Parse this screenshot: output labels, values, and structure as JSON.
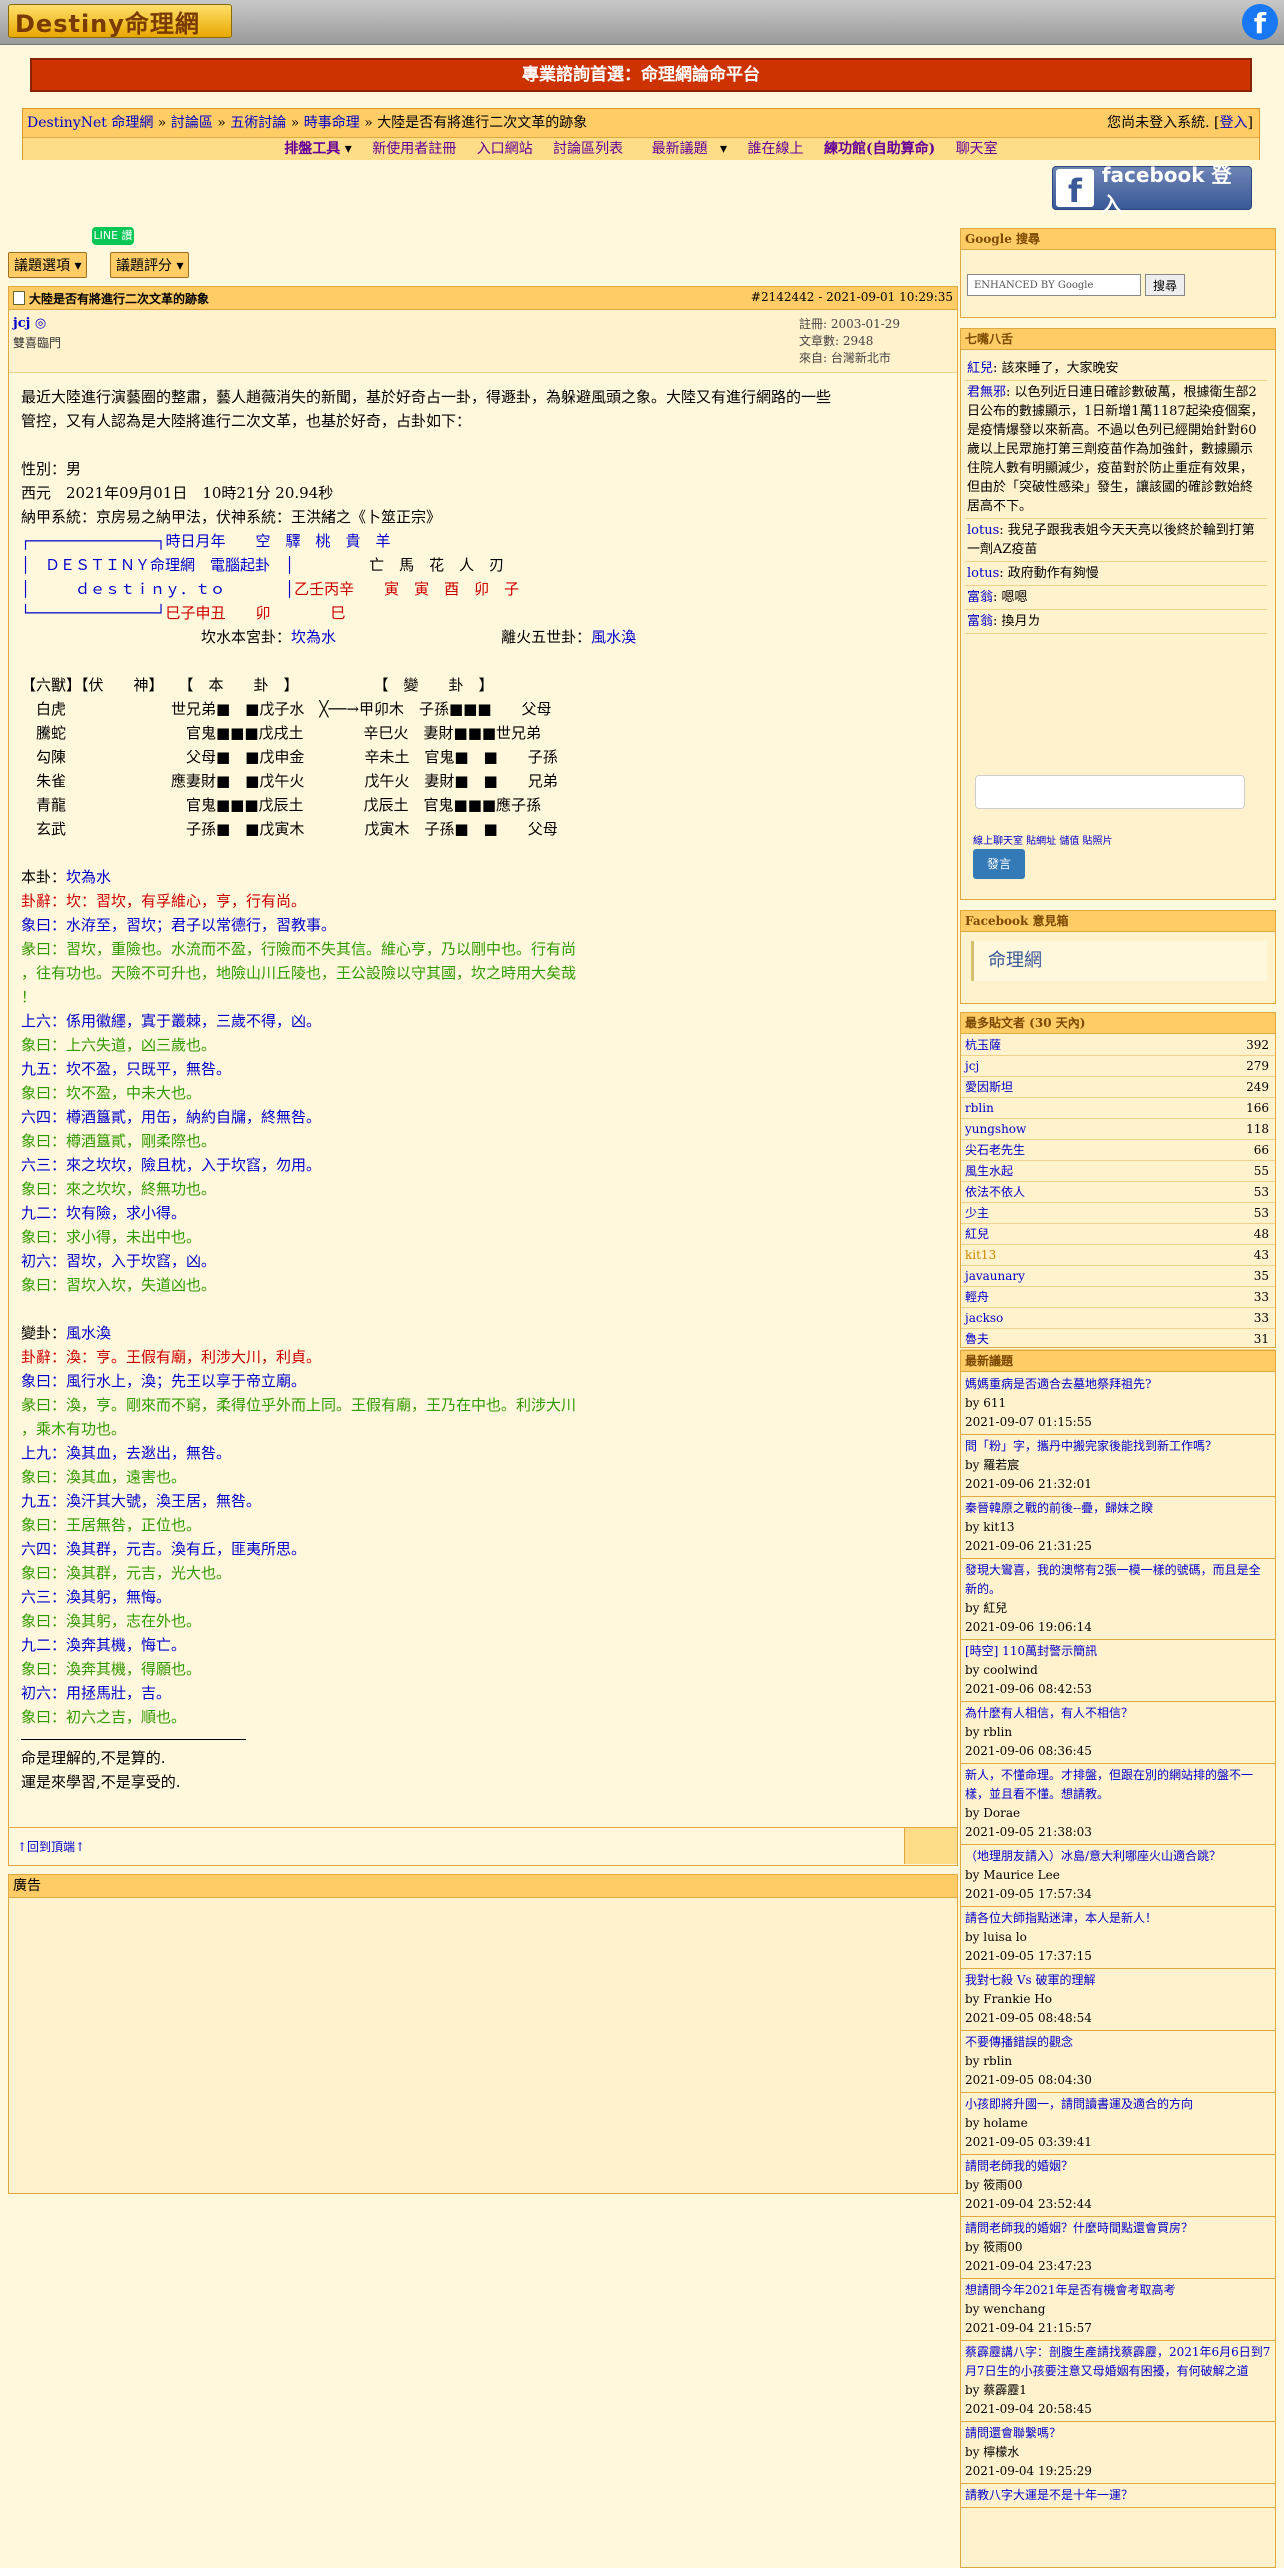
{
  "site": {
    "logo": "Destiny命理網",
    "fb_icon": "f"
  },
  "banner": "專業諮詢首選：命理網論命平台",
  "breadcrumb": {
    "home": "DestinyNet 命理網",
    "forum": "討論區",
    "arts": "五術討論",
    "topic": "時事命理",
    "sep": "»",
    "current": "大陸是否有將進行二次文革的跡象"
  },
  "login_status": {
    "text": "您尚未登入系統. [",
    "link": "登入",
    "close": "]"
  },
  "menu": [
    "排盤工具",
    "新使用者註冊",
    "入口網站",
    "討論區列表",
    "最新議題",
    "誰在線上",
    "練功館(自助算命)",
    "聊天室"
  ],
  "fb_login": "facebook 登入",
  "line_badge": "LINE 讚",
  "topic_options": "議題選項",
  "topic_rating": "議題評分",
  "post": {
    "title": "大陸是否有將進行二次文革的跡象",
    "id_time": "#2142442 - 2021-09-01 10:29:35",
    "author": "jcj",
    "group": "雙喜臨門",
    "reg": "註冊: 2003-01-29",
    "posts": "文章數: 2948",
    "from": "來自: 台灣新北市",
    "intro1": "最近大陸進行演藝圈的整肅，藝人趙薇消失的新聞，基於好奇占一卦，得遯卦，為躲避風頭之象。大陸又有進行網路的一些",
    "intro2": "管控，又有人認為是大陸將進行二次文革，也基於好奇，占卦如下：",
    "sex": "性別：男",
    "date": "西元　2021年09月01日　10時21分 20.94秒",
    "najia": "納甲系統：京房易之納甲法，伏神系統：王洪緒之《卜筮正宗》",
    "box1": "┌──────────────┐時日月年　　空　驛　桃　貴　羊",
    "box2a": "│　ＤＥＳＴＩＮＹ命理網　電腦起卦　│",
    "box2b": "　　　　　亡　馬　花　人　刃",
    "box3a": "│　　　ｄｅｓｔｉｎｙ．ｔｏ　　　　│",
    "box3b": "乙壬丙辛　　寅　寅　酉　卯　子",
    "box4a": "└──────────────┘",
    "box4b": "巳子申丑　　卯　　　　巳",
    "palace_left": "坎水本宮卦：",
    "palace_left_v": "坎為水",
    "palace_right": "離火五世卦：",
    "palace_right_v": "風水渙",
    "table_head": "【六獸】【伏　　神】　　【　本　　卦　】　　　　　　【　變　　卦　】",
    "rows": [
      "　白虎　　　　　　　世兄弟■　■戊子水　╳──→甲卯木　子孫■■■　　父母",
      "　騰蛇　　　　　　　　官鬼■■■戊戌土　　　　辛巳火　妻財■■■世兄弟",
      "　勾陳　　　　　　　　父母■　■戊申金　　　　辛未土　官鬼■　■　　子孫",
      "　朱雀　　　　　　　應妻財■　■戊午火　　　　戊午火　妻財■　■　　兄弟",
      "　青龍　　　　　　　　官鬼■■■戊辰土　　　　戊辰土　官鬼■■■應子孫",
      "　玄武　　　　　　　　子孫■　■戊寅木　　　　戊寅木　子孫■　■　　父母"
    ],
    "ben_label": "本卦：",
    "ben_name": "坎為水",
    "ben_lines": [
      [
        "red",
        "卦辭：坎：習坎，有孚維心，亨，行有尚。"
      ],
      [
        "blue",
        "象曰：水洊至，習坎；君子以常德行，習教事。"
      ],
      [
        "green",
        "彖曰：習坎，重險也。水流而不盈，行險而不失其信。維心亨，乃以剛中也。行有尚"
      ],
      [
        "green",
        "，往有功也。天險不可升也，地險山川丘陵也，王公設險以守其國，坎之時用大矣哉"
      ],
      [
        "green",
        "！"
      ],
      [
        "blue",
        "上六：係用徽纆，寘于叢棘，三歲不得，凶。"
      ],
      [
        "green",
        "象曰：上六失道，凶三歲也。"
      ],
      [
        "blue",
        "九五：坎不盈，只既平，無咎。"
      ],
      [
        "green",
        "象曰：坎不盈，中未大也。"
      ],
      [
        "blue",
        "六四：樽酒簋貳，用缶，納約自牖，終無咎。"
      ],
      [
        "green",
        "象曰：樽酒簋貳，剛柔際也。"
      ],
      [
        "blue",
        "六三：來之坎坎，險且枕，入于坎窞，勿用。"
      ],
      [
        "green",
        "象曰：來之坎坎，終無功也。"
      ],
      [
        "blue",
        "九二：坎有險，求小得。"
      ],
      [
        "green",
        "象曰：求小得，未出中也。"
      ],
      [
        "blue",
        "初六：習坎，入于坎窞，凶。"
      ],
      [
        "green",
        "象曰：習坎入坎，失道凶也。"
      ]
    ],
    "bian_label": "變卦：",
    "bian_name": "風水渙",
    "bian_lines": [
      [
        "red",
        "卦辭：渙：亨。王假有廟，利涉大川，利貞。"
      ],
      [
        "blue",
        "象曰：風行水上，渙；先王以享于帝立廟。"
      ],
      [
        "green",
        "彖曰：渙，亨。剛來而不窮，柔得位乎外而上同。王假有廟，王乃在中也。利涉大川"
      ],
      [
        "green",
        "，乘木有功也。"
      ],
      [
        "blue",
        "上九：渙其血，去逖出，無咎。"
      ],
      [
        "green",
        "象曰：渙其血，遠害也。"
      ],
      [
        "blue",
        "九五：渙汗其大號，渙王居，無咎。"
      ],
      [
        "green",
        "象曰：王居無咎，正位也。"
      ],
      [
        "blue",
        "六四：渙其群，元吉。渙有丘，匪夷所思。"
      ],
      [
        "green",
        "象曰：渙其群，元吉，光大也。"
      ],
      [
        "blue",
        "六三：渙其躬，無悔。"
      ],
      [
        "green",
        "象曰：渙其躬，志在外也。"
      ],
      [
        "blue",
        "九二：渙奔其機，悔亡。"
      ],
      [
        "green",
        "象曰：渙奔其機，得願也。"
      ],
      [
        "blue",
        "初六：用拯馬壯，吉。"
      ],
      [
        "green",
        "象曰：初六之吉，順也。"
      ]
    ],
    "sig1": "命是理解的,不是算的.",
    "sig2": "運是來學習,不是享受的.",
    "to_top": "↑回到頂端↑"
  },
  "ad_label": "廣告",
  "google": {
    "header": "Google 搜尋",
    "placeholder": "ENHANCED BY Google",
    "button": "搜尋"
  },
  "chat": {
    "header": "七嘴八舌",
    "messages": [
      [
        "紅兒",
        "該來睡了，大家晚安"
      ],
      [
        "君無邪",
        "以色列近日連日確診數破萬，根據衛生部2日公布的數據顯示，1日新增1萬1187起染疫個案，是疫情爆發以來新高。不過以色列已經開始針對60歲以上民眾施打第三劑疫苗作為加強針，數據顯示住院人數有明顯減少，疫苗對於防止重症有效果，但由於「突破性感染」發生，讓該國的確診數始終居高不下。"
      ],
      [
        "lotus",
        "我兒子跟我表姐今天天亮以後終於輪到打第一劑AZ疫苗"
      ],
      [
        "lotus",
        "政府動作有夠慢"
      ],
      [
        "富翁",
        "嗯嗯"
      ],
      [
        "富翁",
        "換月ㄌ"
      ]
    ],
    "links": "線上聊天室 貼網址 儲值 貼照片",
    "send": "發言"
  },
  "fb_fans": {
    "header": "Facebook 意見箱",
    "name": "命理網"
  },
  "top_posters": {
    "header": "最多貼文者 (30 天內)",
    "rows": [
      [
        "杭玉薩",
        "392"
      ],
      [
        "jcj",
        "279"
      ],
      [
        "愛因斯坦",
        "249"
      ],
      [
        "rblin",
        "166"
      ],
      [
        "yungshow",
        "118"
      ],
      [
        "尖石老先生",
        "66"
      ],
      [
        "風生水起",
        "55"
      ],
      [
        "依法不依人",
        "53"
      ],
      [
        "少主",
        "53"
      ],
      [
        "紅兒",
        "48"
      ],
      [
        "kit13",
        "43"
      ],
      [
        "javaunary",
        "35"
      ],
      [
        "輕舟",
        "33"
      ],
      [
        "jackso",
        "33"
      ],
      [
        "魯夫",
        "31"
      ]
    ]
  },
  "latest": {
    "header": "最新議題",
    "items": [
      [
        "媽媽重病是否適合去墓地祭拜祖先?",
        "by 611",
        "2021-09-07 01:15:55"
      ],
      [
        "問「粉」字，攜丹中搬完家後能找到新工作嗎？",
        "by 羅若宸",
        "2021-09-06 21:32:01"
      ],
      [
        "秦晉韓原之戰的前後--疊，歸妹之睽",
        "by kit13",
        "2021-09-06 21:31:25"
      ],
      [
        "發現大鸞喜，我的澳幣有2張一模一樣的號碼，而且是全新的。",
        "by 紅兒",
        "2021-09-06 19:06:14"
      ],
      [
        "[時空] 110萬封警示簡訊",
        "by coolwind",
        "2021-09-06 08:42:53"
      ],
      [
        "為什麼有人相信，有人不相信？",
        "by rblin",
        "2021-09-06 08:36:45"
      ],
      [
        "新人，不懂命理。才排盤，但跟在別的網站排的盤不一樣，並且看不懂。想請教。",
        "by Dorae",
        "2021-09-05 21:38:03"
      ],
      [
        "（地理朋友請入）冰島/意大利哪座火山適合跳？",
        "by Maurice Lee",
        "2021-09-05 17:57:34"
      ],
      [
        "請各位大師指點迷津，本人是新人！",
        "by luisa lo",
        "2021-09-05 17:37:15"
      ],
      [
        "我對七殺 Vs 破軍的理解",
        "by Frankie Ho",
        "2021-09-05 08:48:54"
      ],
      [
        "不要傳播錯誤的觀念",
        "by rblin",
        "2021-09-05 08:04:30"
      ],
      [
        "小孩即將升國一，請問讀書運及適合的方向",
        "by holame",
        "2021-09-05 03:39:41"
      ],
      [
        "請問老師我的婚姻？",
        "by 筱雨00",
        "2021-09-04 23:52:44"
      ],
      [
        "請問老師我的婚姻？什麼時間點還會買房？",
        "by 筱雨00",
        "2021-09-04 23:47:23"
      ],
      [
        "想請問今年2021年是否有機會考取高考",
        "by wenchang",
        "2021-09-04 21:15:57"
      ],
      [
        "蔡霹靂講八字：剖腹生產請找蔡霹靂，2021年6月6日到7月7日生的小孩要注意又母婚姻有困擾，有何破解之道",
        "by 蔡霹靂1",
        "2021-09-04 20:58:45"
      ],
      [
        "請問還會聯繫嗎？",
        "by 檸檬水",
        "2021-09-04 19:25:29"
      ],
      [
        "請教八字大運是不是十年一運？",
        "",
        ""
      ]
    ]
  }
}
